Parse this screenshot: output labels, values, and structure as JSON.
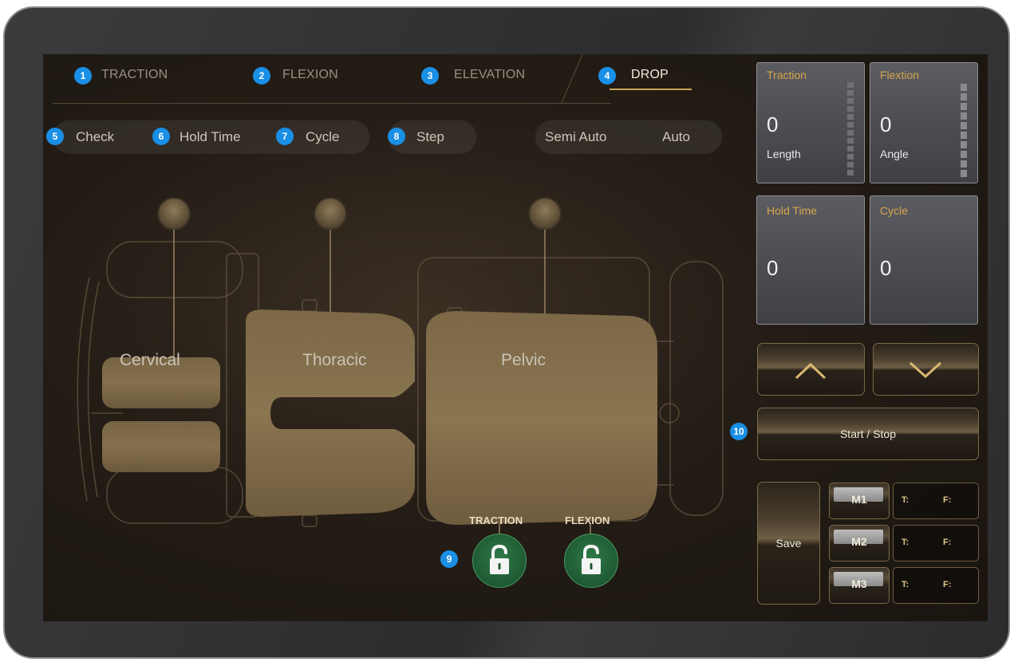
{
  "tabs": [
    {
      "num": "1",
      "label": "TRACTION"
    },
    {
      "num": "2",
      "label": "FLEXION"
    },
    {
      "num": "3",
      "label": "ELEVATION"
    },
    {
      "num": "4",
      "label": "DROP",
      "active": true
    }
  ],
  "controls": {
    "check": {
      "num": "5",
      "label": "Check"
    },
    "hold_time": {
      "num": "6",
      "label": "Hold Time"
    },
    "cycle": {
      "num": "7",
      "label": "Cycle"
    },
    "step": {
      "num": "8",
      "label": "Step"
    },
    "semi_auto": "Semi Auto",
    "auto": "Auto"
  },
  "table_sections": {
    "cervical": "Cervical",
    "thoracic": "Thoracic",
    "pelvic": "Pelvic"
  },
  "locks": {
    "num": "9",
    "traction_label": "TRACTION",
    "flexion_label": "FLEXION",
    "traction_state": "unlocked",
    "flexion_state": "unlocked"
  },
  "panels": {
    "traction": {
      "title": "Traction",
      "value": "0",
      "sub": "Length"
    },
    "flexion": {
      "title": "Flextion",
      "value": "0",
      "sub": "Angle"
    },
    "hold_time": {
      "title": "Hold Time",
      "value": "0"
    },
    "cycle": {
      "title": "Cycle",
      "value": "0"
    }
  },
  "arrows": {
    "up": "chevron-up-icon",
    "down": "chevron-down-icon"
  },
  "start_stop": {
    "num": "10",
    "label": "Start / Stop"
  },
  "memory": {
    "save_label": "Save",
    "slots": [
      {
        "label": "M1",
        "t": "T:",
        "f": "F:"
      },
      {
        "label": "M2",
        "t": "T:",
        "f": "F:"
      },
      {
        "label": "M3",
        "t": "T:",
        "f": "F:"
      }
    ]
  },
  "colors": {
    "badge": "#1a8fe6",
    "gold": "#d9a64a",
    "lock_green": "#1f5a33"
  }
}
